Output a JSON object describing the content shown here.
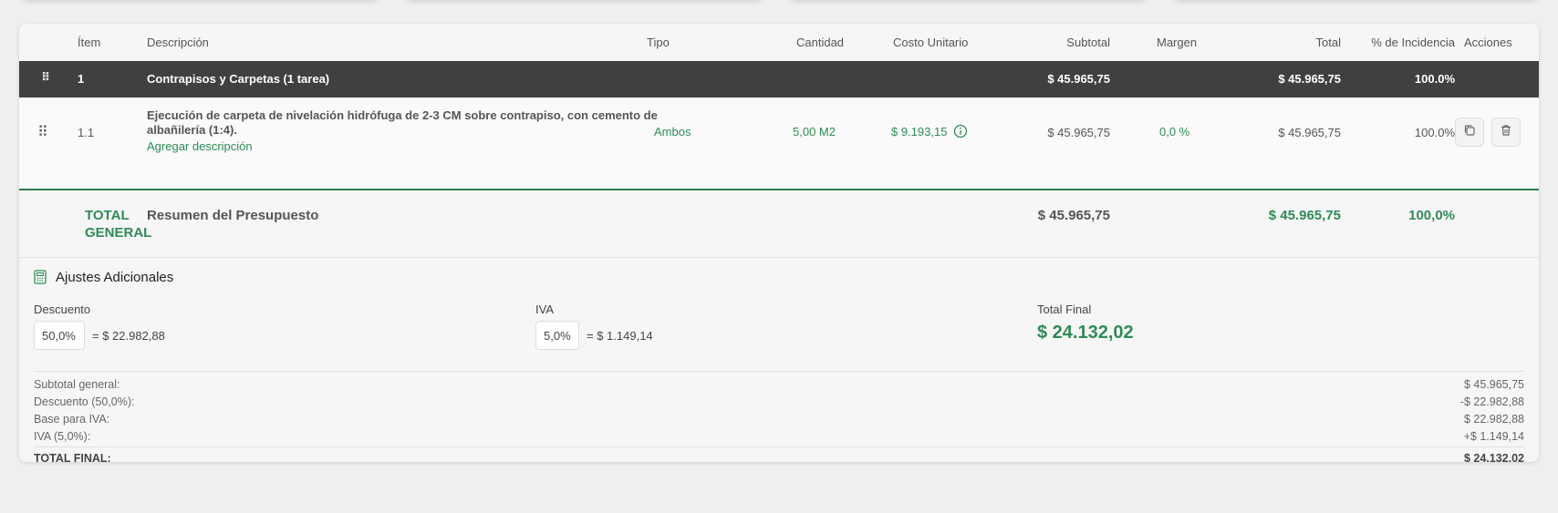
{
  "columns": {
    "item": "Ítem",
    "description": "Descripción",
    "type": "Tipo",
    "quantity": "Cantidad",
    "unit_cost": "Costo Unitario",
    "subtotal": "Subtotal",
    "margin": "Margen",
    "total": "Total",
    "incidence": "% de Incidencia",
    "actions": "Acciones"
  },
  "category": {
    "number": "1",
    "name": "Contrapisos y Carpetas (1 tarea)",
    "subtotal": "$ 45.965,75",
    "total": "$ 45.965,75",
    "incidence": "100.0%"
  },
  "item": {
    "number": "1.1",
    "description_line1": "Ejecución de carpeta de nivelación hidrófuga de 2-3 CM sobre contrapiso, con cemento de",
    "description_line2": "albañilería (1:4).",
    "add_description": "Agregar descripción",
    "type": "Ambos",
    "quantity": "5,00 M2",
    "unit_cost": "$ 9.193,15",
    "subtotal": "$ 45.965,75",
    "margin": "0,0 %",
    "total": "$ 45.965,75",
    "incidence": "100.0%"
  },
  "grand_total": {
    "label_line1": "TOTAL",
    "label_line2": "GENERAL",
    "name": "Resumen del Presupuesto",
    "subtotal": "$ 45.965,75",
    "total": "$ 45.965,75",
    "incidence": "100,0%"
  },
  "adjustments": {
    "title": "Ajustes Adicionales",
    "discount_label": "Descuento",
    "discount_value": "50,0%",
    "discount_result": "=   $ 22.982,88",
    "iva_label": "IVA",
    "iva_value": "5,0%",
    "iva_result": "=   $ 1.149,14",
    "final_label": "Total Final",
    "final_value": "$ 24.132,02"
  },
  "summary": {
    "subtotal_label": "Subtotal general:",
    "subtotal_value": "$ 45.965,75",
    "discount_label": "Descuento (50,0%):",
    "discount_value": "-$ 22.982,88",
    "base_label": "Base para IVA:",
    "base_value": "$ 22.982,88",
    "iva_label": "IVA (5,0%):",
    "iva_value": "+$ 1.149,14",
    "final_label": "TOTAL FINAL:",
    "final_value": "$ 24.132,02"
  },
  "colors": {
    "accent_green": "#2e8b57",
    "category_bg": "#404040"
  }
}
